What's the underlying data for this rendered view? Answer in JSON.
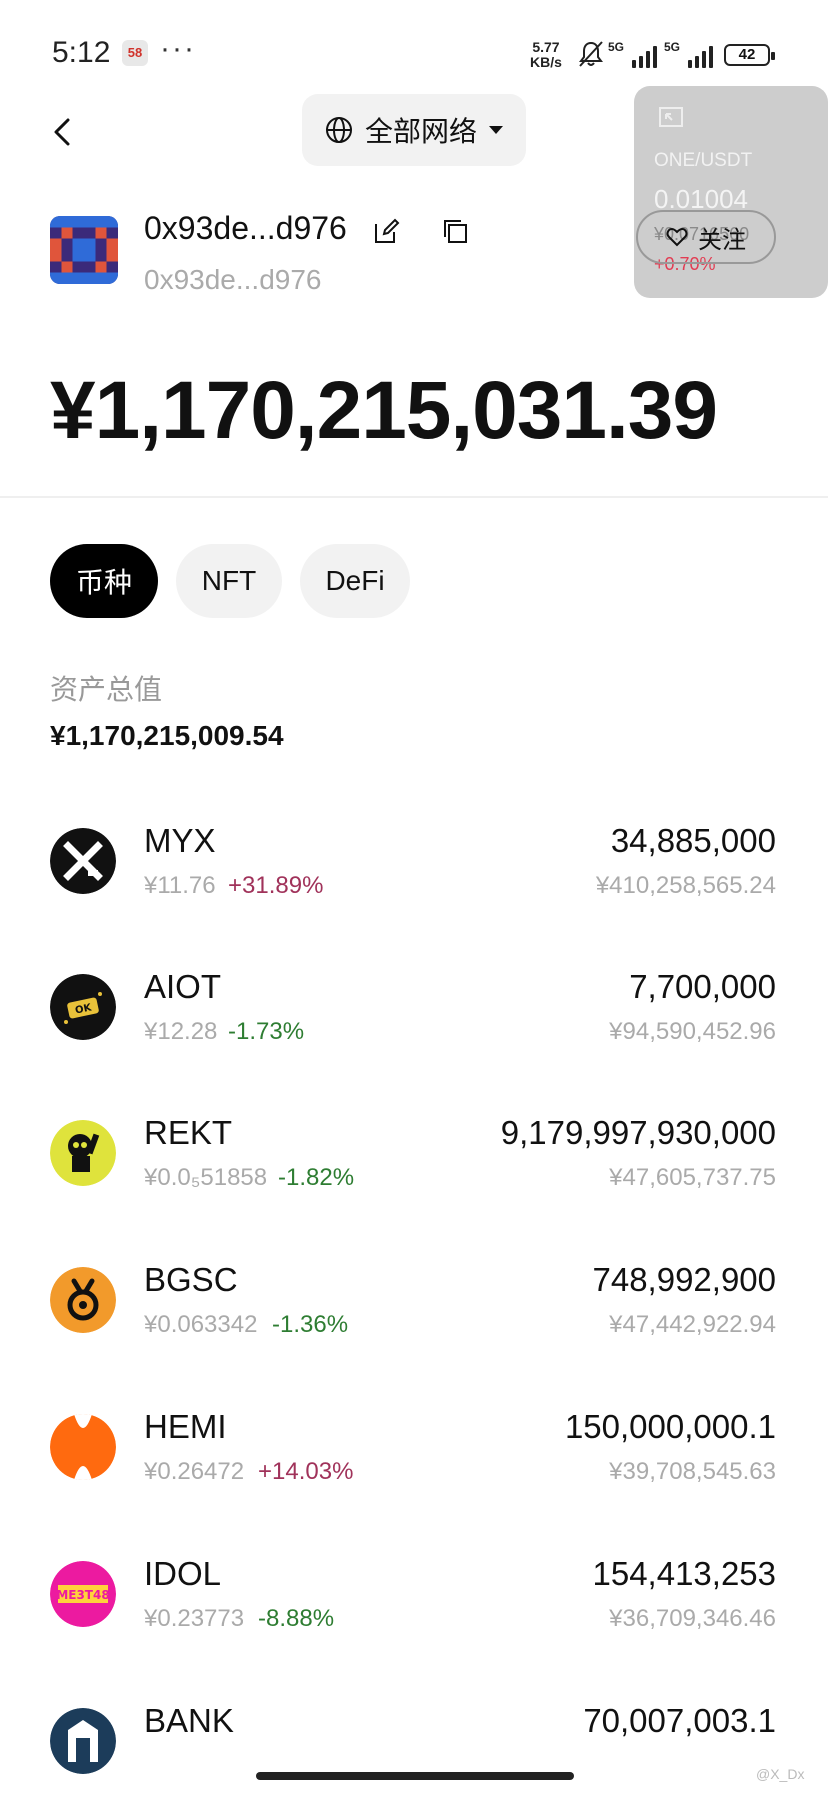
{
  "status_bar": {
    "time": "5:12",
    "app_badge": "58",
    "more": "···",
    "net_speed_top": "5.77",
    "net_speed_unit": "KB/s",
    "sig1_label": "5G",
    "sig2_label": "5G",
    "battery": "42"
  },
  "header": {
    "network_label": "全部网络",
    "follow_label": "关注"
  },
  "price_card": {
    "pair": "ONE/USDT",
    "price": "0.01004",
    "price_cny": "¥0.0716560",
    "change": "+0.70%"
  },
  "account": {
    "name": "0x93de...d976",
    "address": "0x93de...d976",
    "total": "¥1,170,215,031.39"
  },
  "tabs": [
    {
      "label": "币种"
    },
    {
      "label": "NFT"
    },
    {
      "label": "DeFi"
    }
  ],
  "assets": {
    "label": "资产总值",
    "value": "¥1,170,215,009.54"
  },
  "tokens": [
    {
      "symbol": "MYX",
      "price": "¥11.76",
      "change": "+31.89%",
      "qty": "34,885,000",
      "value": "¥410,258,565.24"
    },
    {
      "symbol": "AIOT",
      "price": "¥12.28",
      "change": "-1.73%",
      "qty": "7,700,000",
      "value": "¥94,590,452.96"
    },
    {
      "symbol": "REKT",
      "price": "¥0.0₅51858",
      "change": "-1.82%",
      "qty": "9,179,997,930,000",
      "value": "¥47,605,737.75"
    },
    {
      "symbol": "BGSC",
      "price": "¥0.063342",
      "change": "-1.36%",
      "qty": "748,992,900",
      "value": "¥47,442,922.94"
    },
    {
      "symbol": "HEMI",
      "price": "¥0.26472",
      "change": "+14.03%",
      "qty": "150,000,000.1",
      "value": "¥39,708,545.63"
    },
    {
      "symbol": "IDOL",
      "price": "¥0.23773",
      "change": "-8.88%",
      "qty": "154,413,253",
      "value": "¥36,709,346.46"
    },
    {
      "symbol": "BANK",
      "price": "",
      "change": "",
      "qty": "70,007,003.1",
      "value": ""
    }
  ],
  "colors": {
    "up": "#a0325a",
    "down": "#2e7d32",
    "card_bg": "#cdcdcd"
  },
  "watermark": "@X_Dx"
}
